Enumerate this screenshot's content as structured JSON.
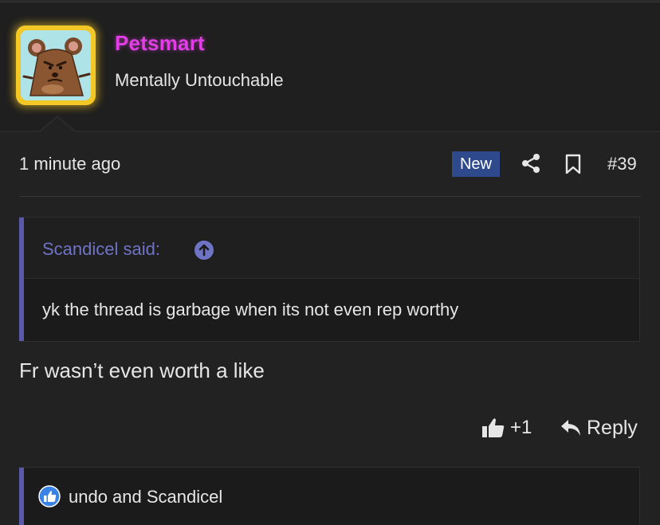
{
  "post": {
    "author": {
      "name": "Petsmart",
      "title": "Mentally Untouchable",
      "avatar": "cartoon-mouse-avatar",
      "name_color": "#e23ee6",
      "avatar_border_color": "#f3c726"
    },
    "timestamp": "1 minute ago",
    "badge": "New",
    "post_number": "#39",
    "icons": {
      "share": "share-icon",
      "bookmark": "bookmark-icon"
    },
    "quote": {
      "author_label": "Scandicel said:",
      "text": "yk the thread is garbage when its not even rep worthy",
      "accent_color": "#6f73c6"
    },
    "message": "Fr wasn’t even worth a like",
    "actions": {
      "like_count": "+1",
      "reply_label": "Reply"
    },
    "reactions": {
      "text": "undo and Scandicel",
      "icon": "like-reaction-icon"
    }
  }
}
